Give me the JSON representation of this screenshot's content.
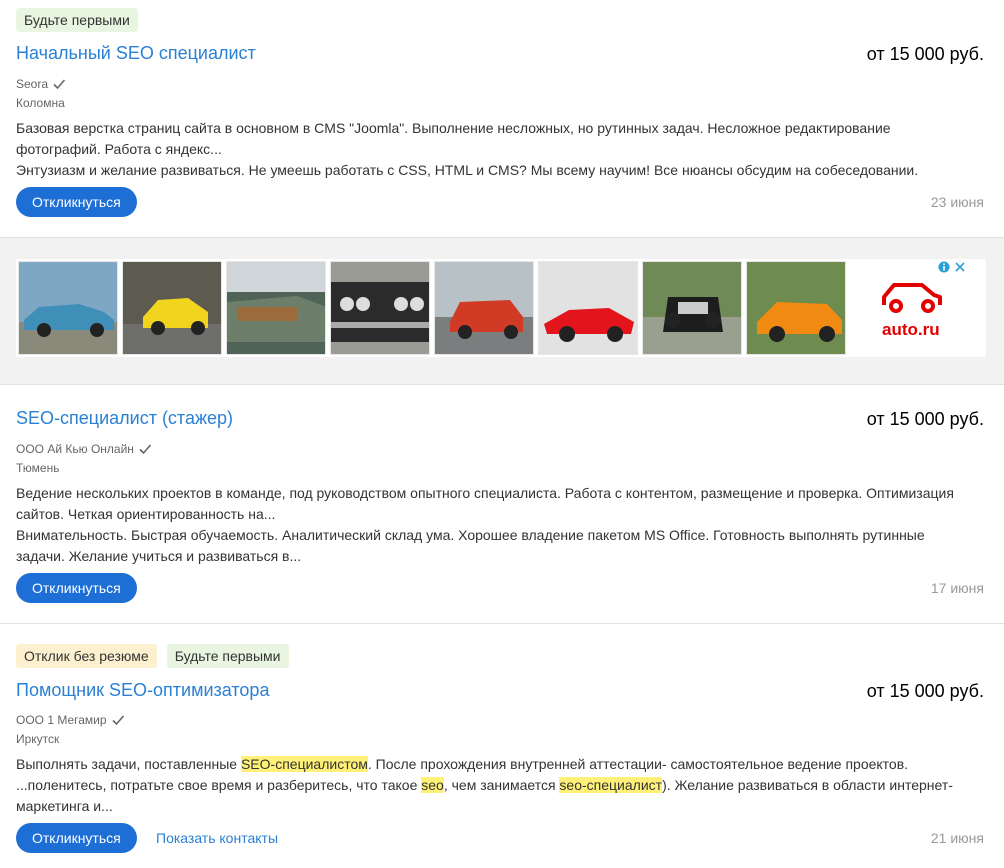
{
  "vacancies": [
    {
      "badges": [
        "Будьте первыми"
      ],
      "title": "Начальный SEO специалист",
      "salary": "от 15 000 руб.",
      "company": "Seora",
      "city": "Коломна",
      "desc_line1": "Базовая верстка страниц сайта в основном в CMS \"Joomla\". Выполнение несложных, но рутинных задач. Несложное редактирование",
      "desc_line2": "фотографий. Работа с яндекс...",
      "desc_line3": "Энтузиазм и желание развиваться. Не умеешь работать с CSS, HTML и CMS? Мы всему научим! Все нюансы обсудим на собеседовании.",
      "button": "Откликнуться",
      "date": "23 июня"
    },
    {
      "title": "SEO-специалист (стажер)",
      "salary": "от 15 000 руб.",
      "company": "ООО Ай Кью Онлайн",
      "city": "Тюмень",
      "desc_line1": "Ведение нескольких проектов в команде, под руководством опытного специалиста. Работа с контентом, размещение и проверка. Оптимизация",
      "desc_line2": "сайтов. Четкая ориентированность на...",
      "desc_line3": "Внимательность. Быстрая обучаемость. Аналитический склад ума. Хорошее владение пакетом MS Office. Готовность выполнять рутинные",
      "desc_line4": "задачи. Желание учиться и развиваться в...",
      "button": "Откликнуться",
      "date": "17 июня"
    },
    {
      "badges": [
        "Отклик без резюме",
        "Будьте первыми"
      ],
      "title": "Помощник SEO-оптимизатора",
      "salary": "от 15 000 руб.",
      "company": "ООО 1 Мегамир",
      "city": "Иркутск",
      "d1_a": "Выполнять задачи, поставленные ",
      "d1_hl1": "SEO",
      "d1_b": "-",
      "d1_hl2": "специалистом",
      "d1_c": ". После прохождения внутренней аттестации- самостоятельное ведение проектов.",
      "d2_a": "...поленитесь, потратьте свое время и разберитесь, что такое ",
      "d2_hl1": "seo",
      "d2_b": ", чем занимается ",
      "d2_hl2": "seo",
      "d2_c": "-",
      "d2_hl3": "специалист",
      "d2_d": "). Желание развиваться в области интернет-",
      "d3": "маркетинга и...",
      "button": "Откликнуться",
      "contacts_link": "Показать контакты",
      "date": "21 июня"
    }
  ],
  "ad": {
    "brand": "auto.ru",
    "brand_color": "#e30000",
    "info_icon": "info-icon",
    "close_icon": "close-icon",
    "images": [
      "blue-retro-car",
      "yellow-sports-car",
      "rusty-green-car",
      "black-classic-car",
      "red-hatchback",
      "red-ferrari",
      "black-vintage-car",
      "orange-lamborghini"
    ]
  },
  "colors": {
    "accent": "#2a80d5",
    "button": "#1d6fd6",
    "badge_green": "#e8f5e0",
    "badge_yellow": "#fcf0cf",
    "highlight": "#fff177"
  }
}
